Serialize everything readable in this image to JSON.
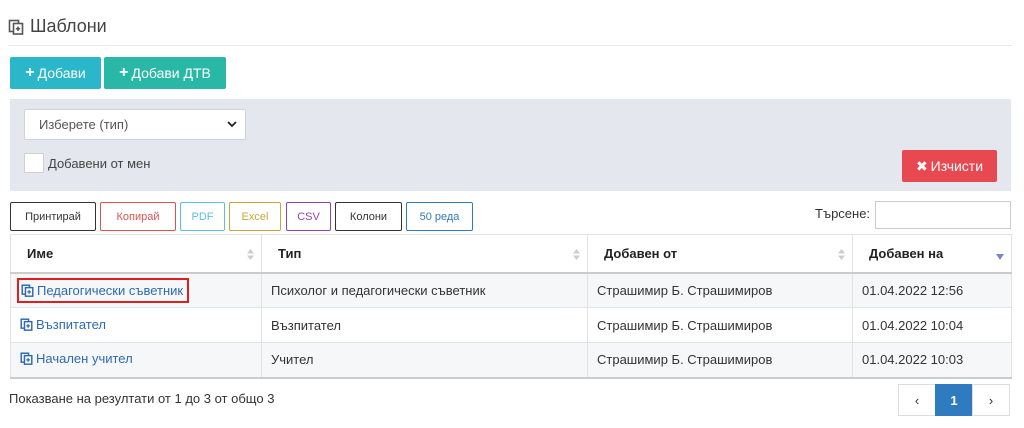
{
  "header": {
    "title": "Шаблони"
  },
  "toolbar": {
    "add_label": "Добави",
    "add_dtv_label": "Добави ДТВ"
  },
  "filters": {
    "type_select_value": "Изберете (тип)",
    "added_by_me_label": "Добавени от мен",
    "clear_label": "Изчисти"
  },
  "export_buttons": [
    {
      "label": "Принтирай",
      "color": "#333333"
    },
    {
      "label": "Копирай",
      "color": "#d9534f"
    },
    {
      "label": "PDF",
      "color": "#5bc0de"
    },
    {
      "label": "Excel",
      "color": "#c9a33b"
    },
    {
      "label": "CSV",
      "color": "#8e44ad"
    },
    {
      "label": "Колони",
      "color": "#333333"
    },
    {
      "label": "50 реда",
      "color": "#337ab7"
    }
  ],
  "search": {
    "label": "Търсене:",
    "value": ""
  },
  "table": {
    "columns": [
      "Име",
      "Тип",
      "Добавен от",
      "Добавен на"
    ],
    "rows": [
      {
        "name": "Педагогически съветник",
        "type": "Психолог и педагогически съветник",
        "added_by": "Страшимир Б. Страшимиров",
        "added_on": "01.04.2022 12:56"
      },
      {
        "name": "Възпитател",
        "type": "Възпитател",
        "added_by": "Страшимир Б. Страшимиров",
        "added_on": "01.04.2022 10:04"
      },
      {
        "name": "Начален учител",
        "type": "Учител",
        "added_by": "Страшимир Б. Страшимиров",
        "added_on": "01.04.2022 10:03"
      }
    ]
  },
  "footer": {
    "info": "Показване на резултати от 1 до 3 от общо 3",
    "pages": [
      "‹",
      "1",
      "›"
    ]
  },
  "colors": {
    "primary": "#2ab7c9",
    "teal": "#2ab8a6",
    "danger": "#e8484f",
    "link": "#2e6ab3",
    "page_active": "#2f7bbf"
  }
}
